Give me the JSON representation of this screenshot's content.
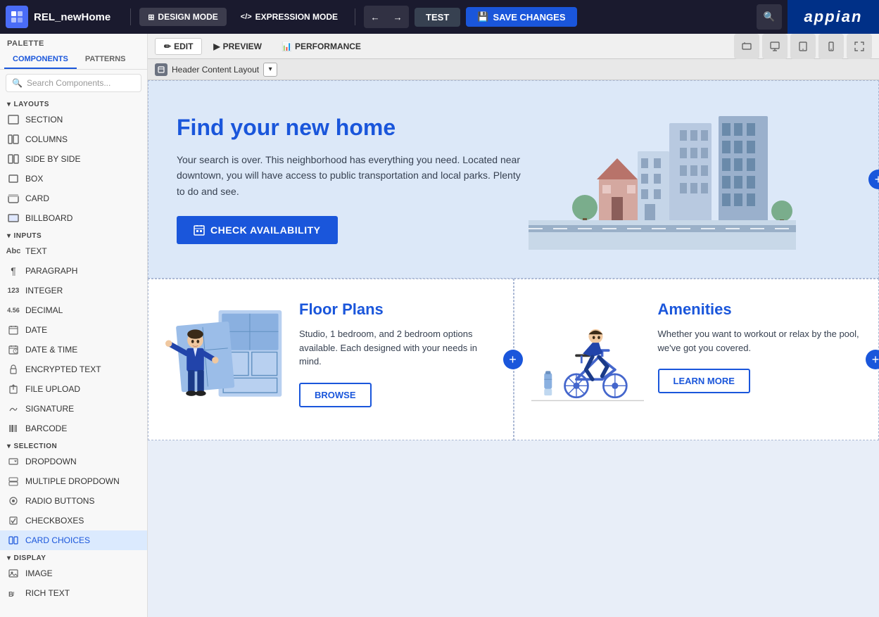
{
  "topbar": {
    "app_name": "REL_newHome",
    "design_mode_label": "DESIGN MODE",
    "expression_mode_label": "EXPRESSION MODE",
    "test_label": "TEST",
    "save_changes_label": "SAVE CHANGES",
    "appian_label": "appian"
  },
  "palette": {
    "header": "PALETTE",
    "tab_components": "COMPONENTS",
    "tab_patterns": "PATTERNS",
    "search_placeholder": "Search Components...",
    "sections": {
      "layouts": {
        "header": "LAYOUTS",
        "items": [
          {
            "label": "SECTION",
            "icon": "section-icon"
          },
          {
            "label": "COLUMNS",
            "icon": "columns-icon"
          },
          {
            "label": "SIDE BY SIDE",
            "icon": "sidebyside-icon"
          },
          {
            "label": "BOX",
            "icon": "box-icon"
          },
          {
            "label": "CARD",
            "icon": "card-icon"
          },
          {
            "label": "BILLBOARD",
            "icon": "billboard-icon"
          }
        ]
      },
      "inputs": {
        "header": "INPUTS",
        "items": [
          {
            "label": "TEXT",
            "icon": "text-icon"
          },
          {
            "label": "PARAGRAPH",
            "icon": "paragraph-icon"
          },
          {
            "label": "INTEGER",
            "icon": "integer-icon"
          },
          {
            "label": "DECIMAL",
            "icon": "decimal-icon"
          },
          {
            "label": "DATE",
            "icon": "date-icon"
          },
          {
            "label": "DATE & TIME",
            "icon": "datetime-icon"
          },
          {
            "label": "ENCRYPTED TEXT",
            "icon": "encrypted-icon"
          },
          {
            "label": "FILE UPLOAD",
            "icon": "fileupload-icon"
          },
          {
            "label": "SIGNATURE",
            "icon": "signature-icon"
          },
          {
            "label": "BARCODE",
            "icon": "barcode-icon"
          }
        ]
      },
      "selection": {
        "header": "SELECTION",
        "items": [
          {
            "label": "DROPDOWN",
            "icon": "dropdown-icon"
          },
          {
            "label": "MULTIPLE DROPDOWN",
            "icon": "multidropdown-icon"
          },
          {
            "label": "RADIO BUTTONS",
            "icon": "radio-icon"
          },
          {
            "label": "CHECKBOXES",
            "icon": "checkbox-icon"
          },
          {
            "label": "CARD CHOICES",
            "icon": "cardchoices-icon"
          }
        ]
      },
      "display": {
        "header": "DISPLAY",
        "items": [
          {
            "label": "IMAGE",
            "icon": "image-icon"
          },
          {
            "label": "RICH TEXT",
            "icon": "richtext-icon"
          }
        ]
      }
    }
  },
  "edit_tabs": [
    {
      "label": "EDIT",
      "active": true
    },
    {
      "label": "PREVIEW",
      "active": false
    },
    {
      "label": "PERFORMANCE",
      "active": false
    }
  ],
  "breadcrumb": {
    "label": "Header Content Layout"
  },
  "canvas": {
    "hero": {
      "title": "Find your new home",
      "description": "Your search is over. This neighborhood has everything you need. Located near downtown, you will have access to public transportation and local parks. Plenty to do and see.",
      "button_label": "CHECK AVAILABILITY"
    },
    "cards": [
      {
        "title": "Floor Plans",
        "description": "Studio, 1 bedroom, and 2 bedroom options available. Each designed with your needs in mind.",
        "button_label": "BROWSE"
      },
      {
        "title": "Amenities",
        "description": "Whether you want to workout or relax by the pool, we've got you covered.",
        "button_label": "LEARN MORE"
      }
    ]
  }
}
